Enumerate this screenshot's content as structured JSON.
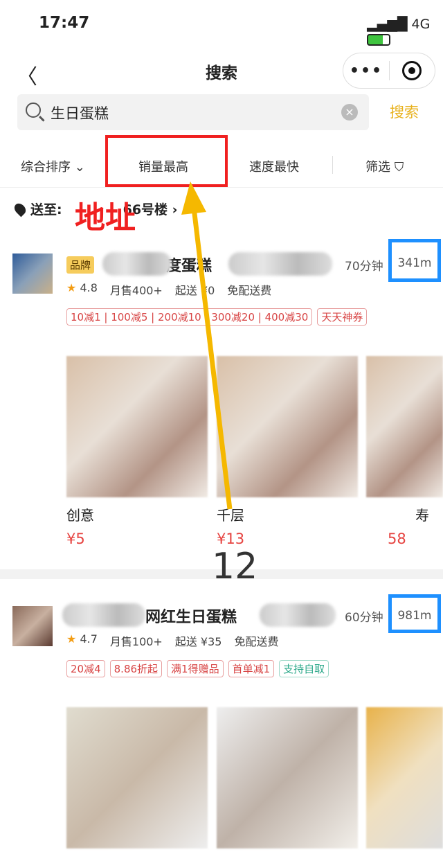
{
  "status": {
    "time": "17:47",
    "network": "4G"
  },
  "nav": {
    "title": "搜索",
    "back_icon": "chevron-left-icon"
  },
  "search": {
    "value": "生日蛋糕",
    "button": "搜索"
  },
  "filters": [
    {
      "label": "综合排序 ⌄"
    },
    {
      "label": "销量最高"
    },
    {
      "label": "速度最快"
    },
    {
      "label": "筛选 ⛉"
    }
  ],
  "address": {
    "prefix": "送至:",
    "text": "66号楼 ›"
  },
  "shops": [
    {
      "badge": "品牌",
      "name_fragment": "度蛋糕",
      "eta": "70分钟",
      "distance": "341m",
      "rating": "4.8",
      "monthly": "月售400+",
      "min_order": "起送 ¥0",
      "delivery": "免配送费",
      "tags": [
        "10减1 | 100减5 | 200减10 | 300减20 | 400减30",
        "天天神券"
      ],
      "products": [
        {
          "name": "创意",
          "price": "¥5"
        },
        {
          "name": "千层",
          "price": "¥13"
        },
        {
          "name": "寿",
          "price": "58"
        }
      ]
    },
    {
      "name_fragment": "网红生日蛋糕",
      "eta": "60分钟",
      "distance": "981m",
      "rating": "4.7",
      "monthly": "月售100+",
      "min_order": "起送 ¥35",
      "delivery": "免配送费",
      "tags": [
        "20减4",
        "8.86折起",
        "满1得赠品",
        "首单减1"
      ],
      "tags_green": [
        "支持自取"
      ]
    }
  ],
  "annotations": {
    "address_label": "地址",
    "number": "12",
    "red": "#f02020",
    "blue": "#1e90ff",
    "arrow": "#f5b800"
  }
}
